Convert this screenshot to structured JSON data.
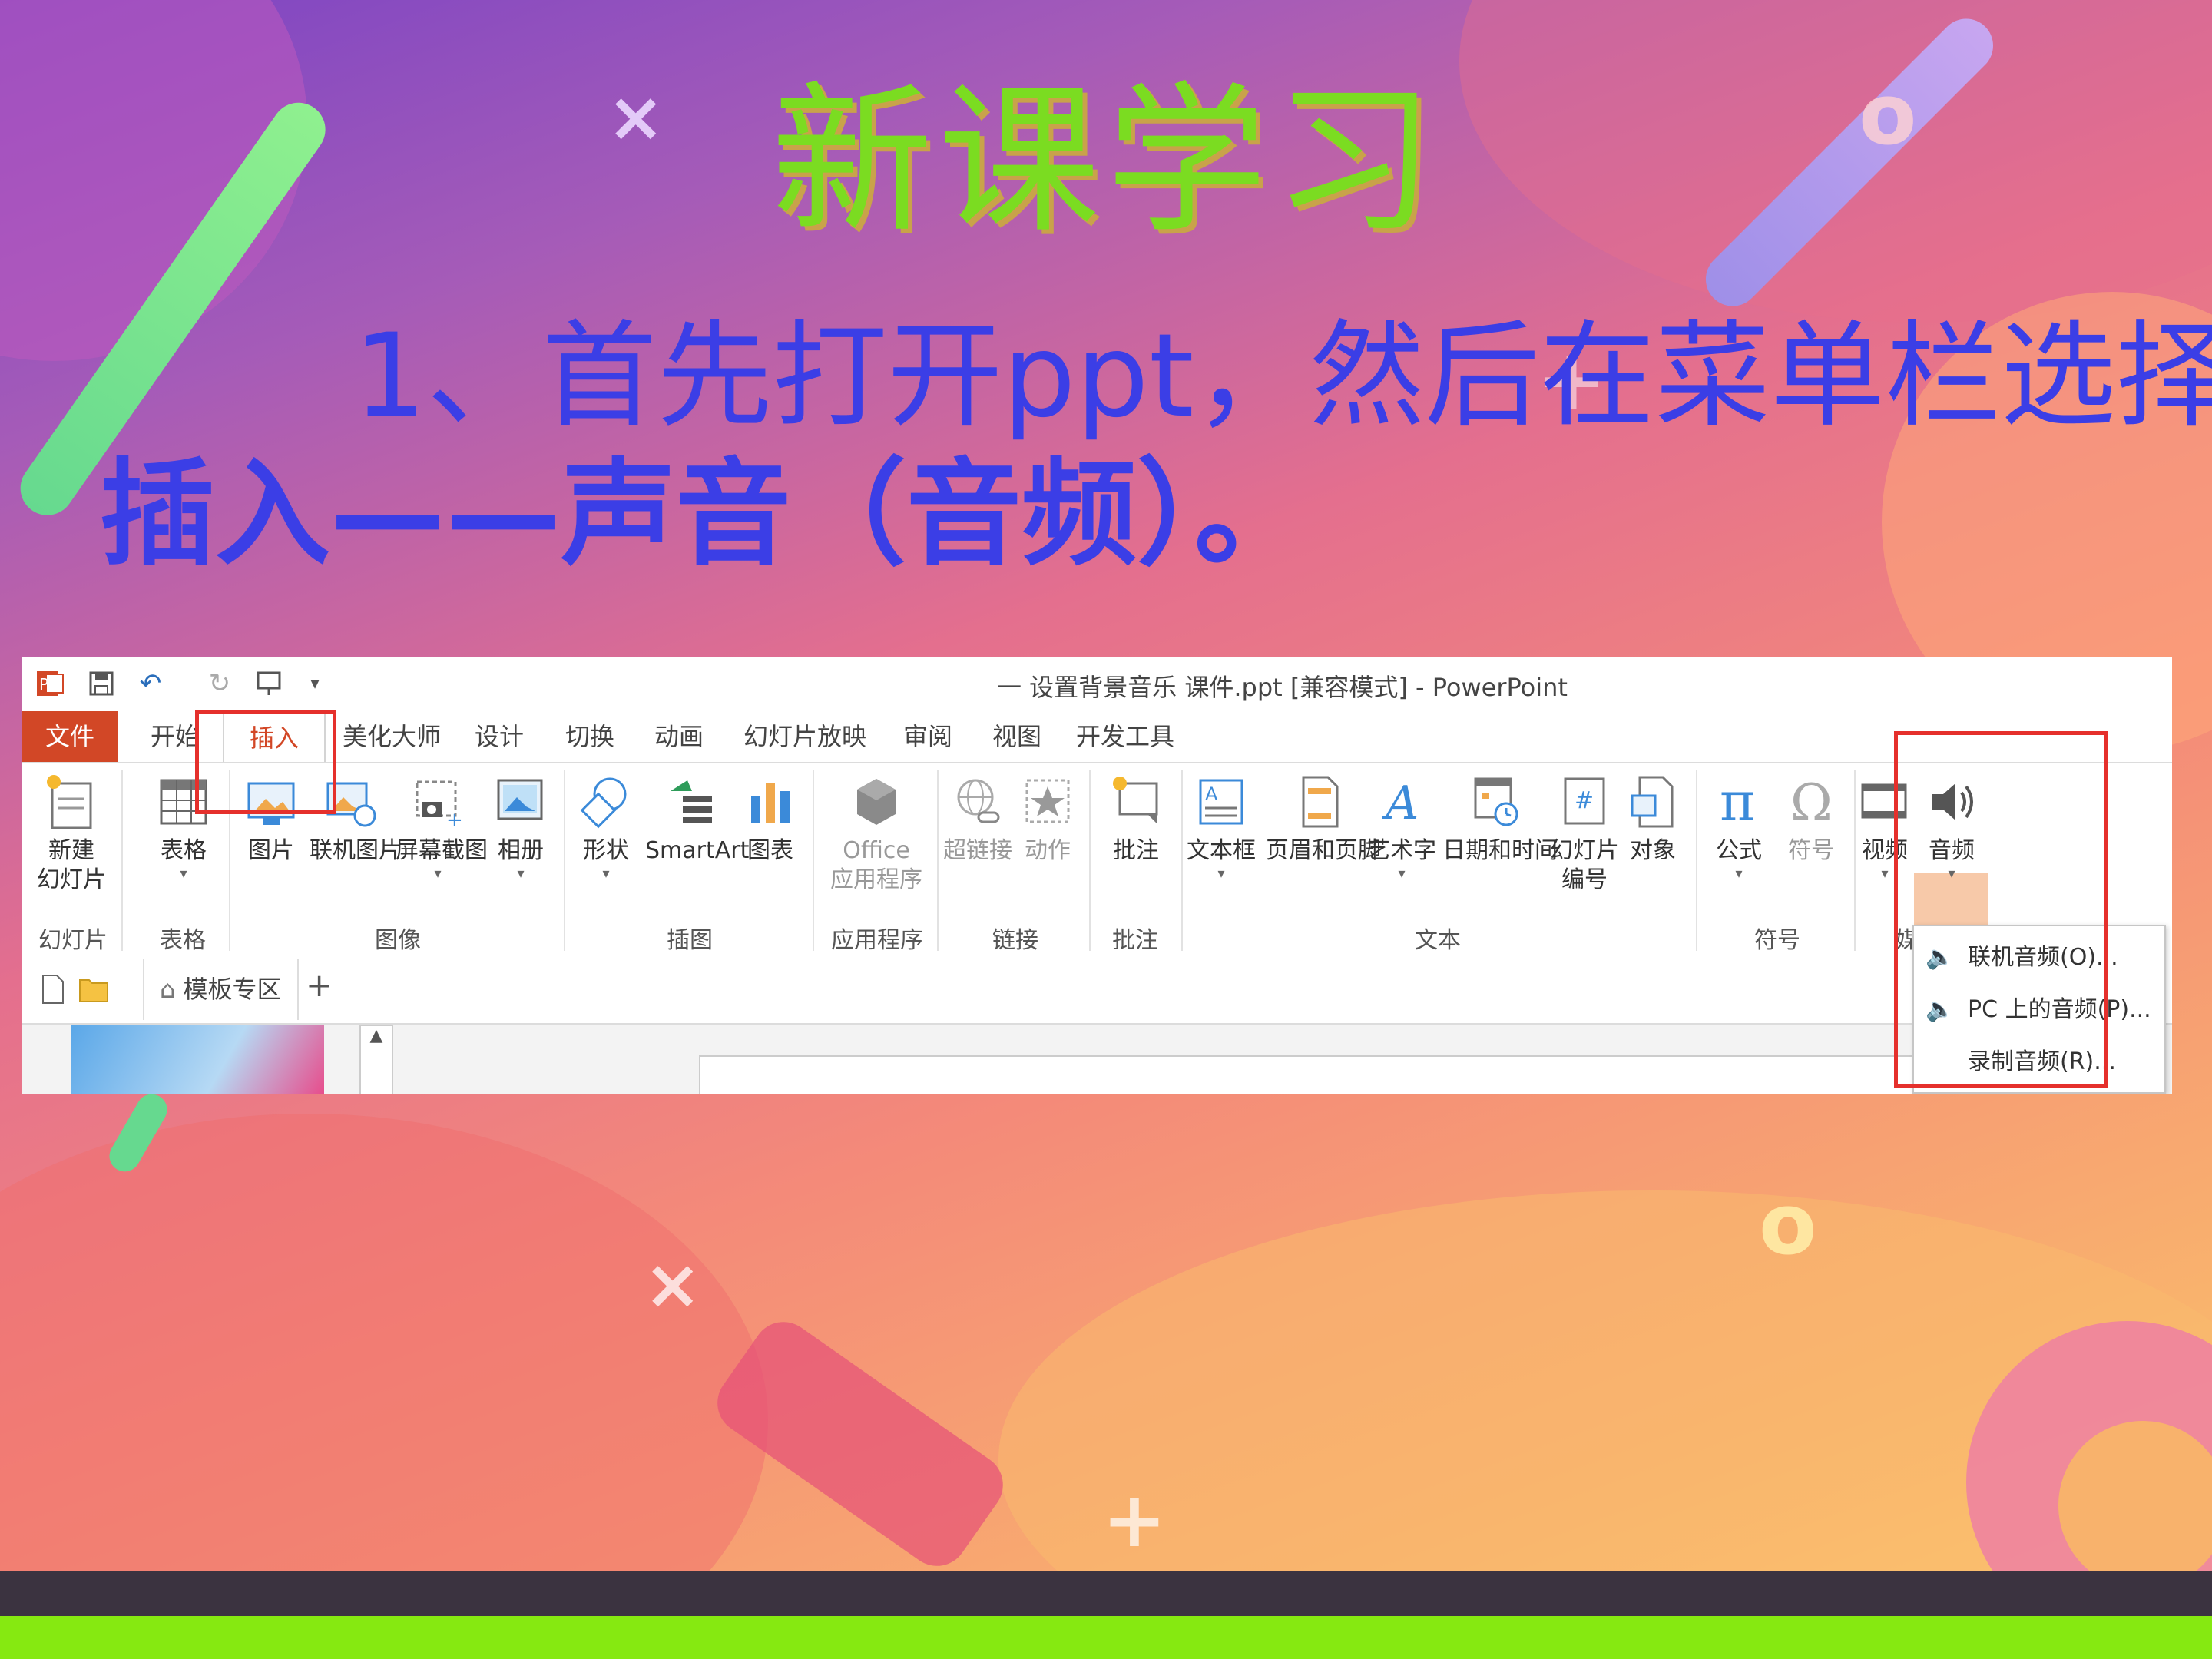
{
  "slide": {
    "title": "新课学习",
    "instruction_line1": "1、首先打开ppt，然后在菜单栏选择",
    "instruction_line2": "插入——声音（音频）。",
    "decorations": {
      "cross": "×",
      "plus": "+",
      "ring": "o"
    },
    "colors": {
      "title": "#7bdc21",
      "text": "#3b3ee6",
      "highlight_box": "#e5302c"
    }
  },
  "window": {
    "title": "一 设置背景音乐 课件.ppt [兼容模式] - PowerPoint",
    "qat": [
      "ppt-logo-icon",
      "save-icon",
      "undo-icon",
      "redo-icon",
      "presentation-icon",
      "customize-icon"
    ]
  },
  "tabs": [
    "文件",
    "开始",
    "插入",
    "美化大师",
    "设计",
    "切换",
    "动画",
    "幻灯片放映",
    "审阅",
    "视图",
    "开发工具"
  ],
  "active_tab": "插入",
  "ribbon": {
    "buttons": {
      "new_slide": "新建\n幻灯片",
      "table": "表格",
      "picture": "图片",
      "online_picture": "联机图片",
      "screenshot": "屏幕截图",
      "album": "相册",
      "shapes": "形状",
      "smartart": "SmartArt",
      "chart": "图表",
      "office_apps_1": "Office",
      "office_apps_2": "应用程序",
      "hyperlink": "超链接",
      "action": "动作",
      "comment": "批注",
      "textbox": "文本框",
      "header_footer": "页眉和页脚",
      "wordart": "艺术字",
      "datetime": "日期和时间",
      "slide_number_1": "幻灯片",
      "slide_number_2": "编号",
      "object": "对象",
      "equation": "公式",
      "symbol": "符号",
      "video": "视频",
      "audio": "音频"
    },
    "groups": {
      "slides": "幻灯片",
      "tables": "表格",
      "images": "图像",
      "illustrations": "插图",
      "apps": "应用程序",
      "links": "链接",
      "comments": "批注",
      "text": "文本",
      "symbols": "符号",
      "media": "媒"
    },
    "new_slide_line1": "新建",
    "new_slide_line2": "幻灯片"
  },
  "docbar": {
    "templates": "模板专区",
    "add": "+"
  },
  "audio_menu": {
    "online_audio": "联机音频(O)...",
    "pc_audio": "PC 上的音频(P)...",
    "record_audio": "录制音频(R)..."
  }
}
